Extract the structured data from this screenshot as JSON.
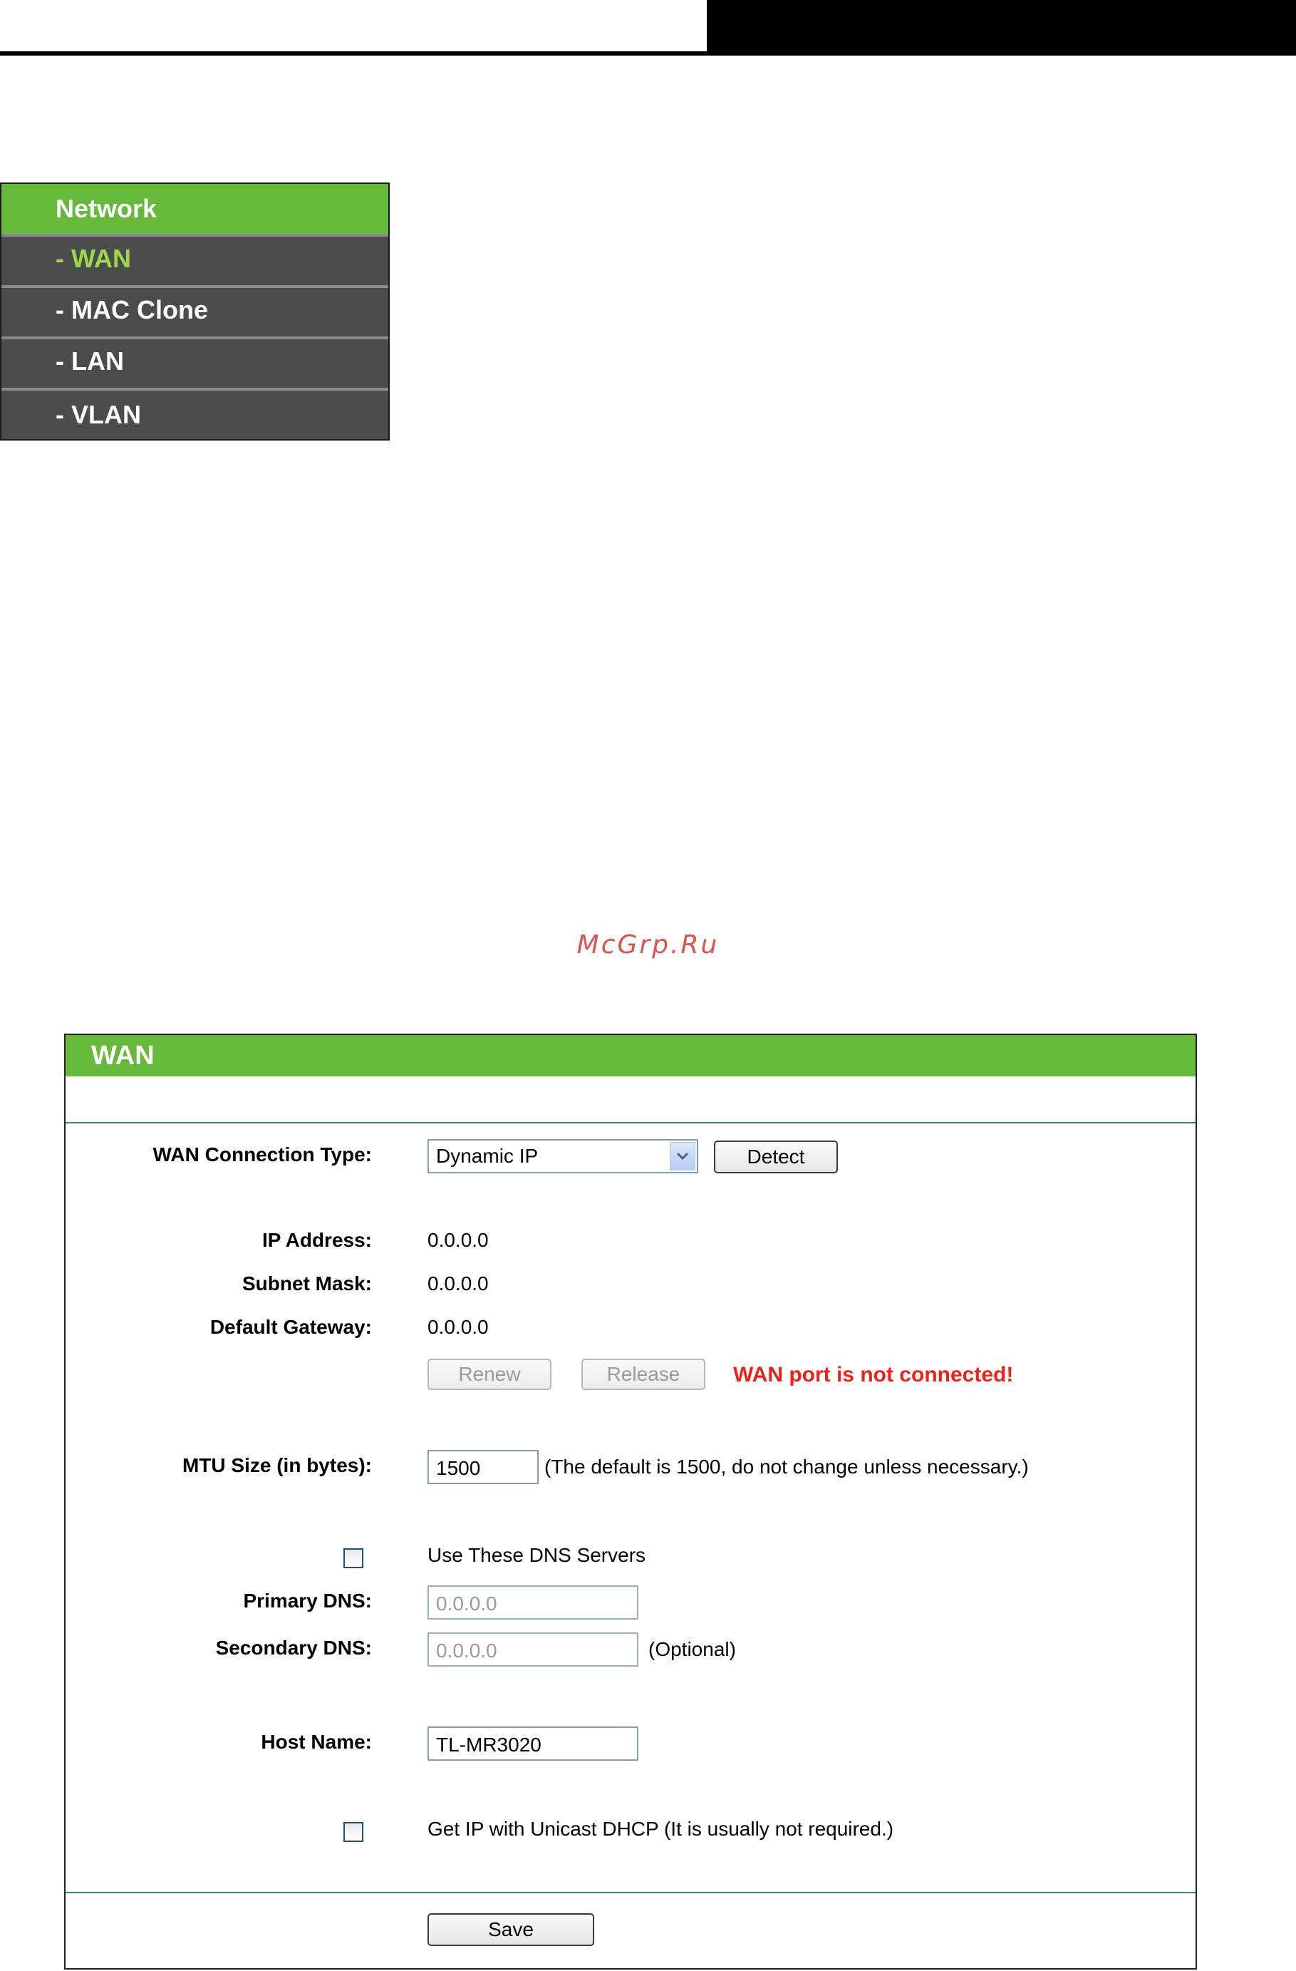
{
  "network_menu": {
    "title": "Network",
    "items": [
      {
        "label": "- WAN",
        "active": true
      },
      {
        "label": "- MAC Clone",
        "active": false
      },
      {
        "label": "- LAN",
        "active": false
      },
      {
        "label": "- VLAN",
        "active": false
      }
    ]
  },
  "watermark": "McGrp.Ru",
  "wan": {
    "title": "WAN",
    "connection_type_label": "WAN Connection Type:",
    "connection_type_value": "Dynamic IP",
    "detect_button": "Detect",
    "ip_address_label": "IP Address:",
    "ip_address_value": "0.0.0.0",
    "subnet_mask_label": "Subnet Mask:",
    "subnet_mask_value": "0.0.0.0",
    "default_gateway_label": "Default Gateway:",
    "default_gateway_value": "0.0.0.0",
    "renew_button": "Renew",
    "release_button": "Release",
    "error_message": "WAN port is not connected!",
    "mtu_label": "MTU Size (in bytes):",
    "mtu_value": "1500",
    "mtu_hint": "(The default is 1500, do not change unless necessary.)",
    "use_dns_label": "Use These DNS Servers",
    "primary_dns_label": "Primary DNS:",
    "primary_dns_value": "0.0.0.0",
    "secondary_dns_label": "Secondary DNS:",
    "secondary_dns_value": "0.0.0.0",
    "secondary_dns_hint": "(Optional)",
    "host_name_label": "Host Name:",
    "host_name_value": "TL-MR3020",
    "unicast_dhcp_label": "Get IP with Unicast DHCP (It is usually not required.)",
    "save_button": "Save"
  },
  "colors": {
    "menu_green": "#66b93a",
    "menu_gray": "#4b4b4b",
    "active_item": "#9bd84a",
    "error_red": "#e8241b",
    "divider": "#3f8a5a"
  }
}
